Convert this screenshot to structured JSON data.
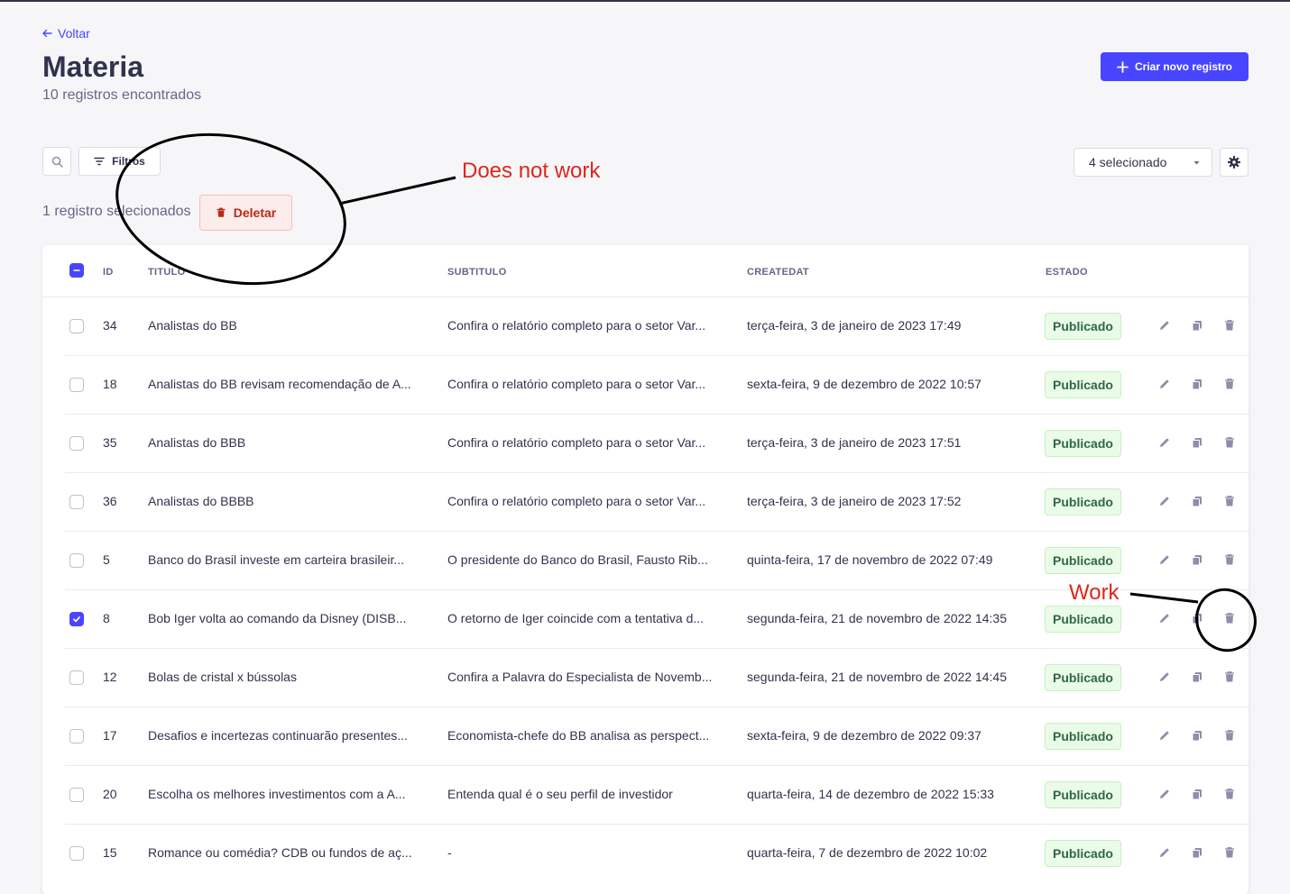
{
  "header": {
    "back_label": "Voltar",
    "title": "Materia",
    "subtitle": "10 registros encontrados",
    "create_label": "Criar novo registro"
  },
  "toolbar": {
    "filters_label": "Filtros",
    "columns_select_value": "4 selecionado",
    "selected_text": "1 registro selecionados",
    "delete_label": "Deletar"
  },
  "table": {
    "headers": {
      "id": "ID",
      "titulo": "TITULO",
      "subtitulo": "SUBTITULO",
      "createdat": "CREATEDAT",
      "estado": "ESTADO"
    },
    "rows": [
      {
        "checked": false,
        "id": "34",
        "titulo": "Analistas do BB",
        "subtitulo": "Confira o relatório completo para o setor Var...",
        "createdat": "terça-feira, 3 de janeiro de 2023 17:49",
        "estado": "Publicado"
      },
      {
        "checked": false,
        "id": "18",
        "titulo": "Analistas do BB revisam recomendação de A...",
        "subtitulo": "Confira o relatório completo para o setor Var...",
        "createdat": "sexta-feira, 9 de dezembro de 2022 10:57",
        "estado": "Publicado"
      },
      {
        "checked": false,
        "id": "35",
        "titulo": "Analistas do BBB",
        "subtitulo": "Confira o relatório completo para o setor Var...",
        "createdat": "terça-feira, 3 de janeiro de 2023 17:51",
        "estado": "Publicado"
      },
      {
        "checked": false,
        "id": "36",
        "titulo": "Analistas do BBBB",
        "subtitulo": "Confira o relatório completo para o setor Var...",
        "createdat": "terça-feira, 3 de janeiro de 2023 17:52",
        "estado": "Publicado"
      },
      {
        "checked": false,
        "id": "5",
        "titulo": "Banco do Brasil investe em carteira brasileir...",
        "subtitulo": "O presidente do Banco do Brasil, Fausto Rib...",
        "createdat": "quinta-feira, 17 de novembro de 2022 07:49",
        "estado": "Publicado"
      },
      {
        "checked": true,
        "id": "8",
        "titulo": "Bob Iger volta ao comando da Disney (DISB...",
        "subtitulo": "O retorno de Iger coincide com a tentativa d...",
        "createdat": "segunda-feira, 21 de novembro de 2022 14:35",
        "estado": "Publicado"
      },
      {
        "checked": false,
        "id": "12",
        "titulo": "Bolas de cristal x bússolas",
        "subtitulo": "Confira a Palavra do Especialista de Novemb...",
        "createdat": "segunda-feira, 21 de novembro de 2022 14:45",
        "estado": "Publicado"
      },
      {
        "checked": false,
        "id": "17",
        "titulo": "Desafios e incertezas continuarão presentes...",
        "subtitulo": "Economista-chefe do BB analisa as perspect...",
        "createdat": "sexta-feira, 9 de dezembro de 2022 09:37",
        "estado": "Publicado"
      },
      {
        "checked": false,
        "id": "20",
        "titulo": "Escolha os melhores investimentos com a A...",
        "subtitulo": "Entenda qual é o seu perfil de investidor",
        "createdat": "quarta-feira, 14 de dezembro de 2022 15:33",
        "estado": "Publicado"
      },
      {
        "checked": false,
        "id": "15",
        "titulo": "Romance ou comédia? CDB ou fundos de aç...",
        "subtitulo": "-",
        "createdat": "quarta-feira, 7 de dezembro de 2022 10:02",
        "estado": "Publicado"
      }
    ]
  },
  "annotations": {
    "does_not_work": "Does not work",
    "work": "Work"
  },
  "colors": {
    "primary": "#4945ff",
    "danger": "#b72b1a",
    "success": "#2f6846",
    "annotation": "#e0261b"
  }
}
